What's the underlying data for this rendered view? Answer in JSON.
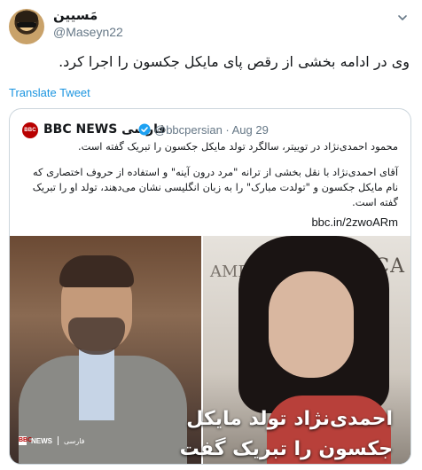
{
  "tweet": {
    "display_name": "مَسیین",
    "handle": "@Maseyn22",
    "text": "وی در ادامه بخشی از رقص پای مایکل جکسون را اجرا کرد.",
    "translate_label": "Translate Tweet"
  },
  "quoted": {
    "name": "BBC NEWS فارسی",
    "logo_text": "BBC",
    "handle_date": "@bbcpersian · Aug 29",
    "paragraph1": "محمود احمدی‌نژاد در توییتر، سالگرد تولد مایکل جکسون را تبریک گفته است.",
    "paragraph2": "آقای احمدی‌نژاد با نقل بخشی از ترانه \"مرد درون آینه\" و استفاده از حروف اختصاری که نام مایکل جکسون و \"تولدت مبارک\" را به زبان انگلیسی نشان می‌دهند، تولد او را تبریک گفته است.",
    "link": "bbc.in/2zwoARm",
    "media": {
      "overlay_text": "احمدی‌نژاد تولد مایکل جکسون را تبریک گفت",
      "sign_text": "AMERICA",
      "sign_text_left": "AMER",
      "badge_bbc": "BBC",
      "badge_news": "NEWS",
      "badge_lang": "فارسی"
    }
  },
  "colors": {
    "link": "#1b95e0",
    "secondary_text": "#657786",
    "border": "#ccd6dd",
    "bbc_red": "#b80000"
  },
  "icons": {
    "caret": "chevron-down-icon",
    "verified": "verified-badge-icon"
  }
}
